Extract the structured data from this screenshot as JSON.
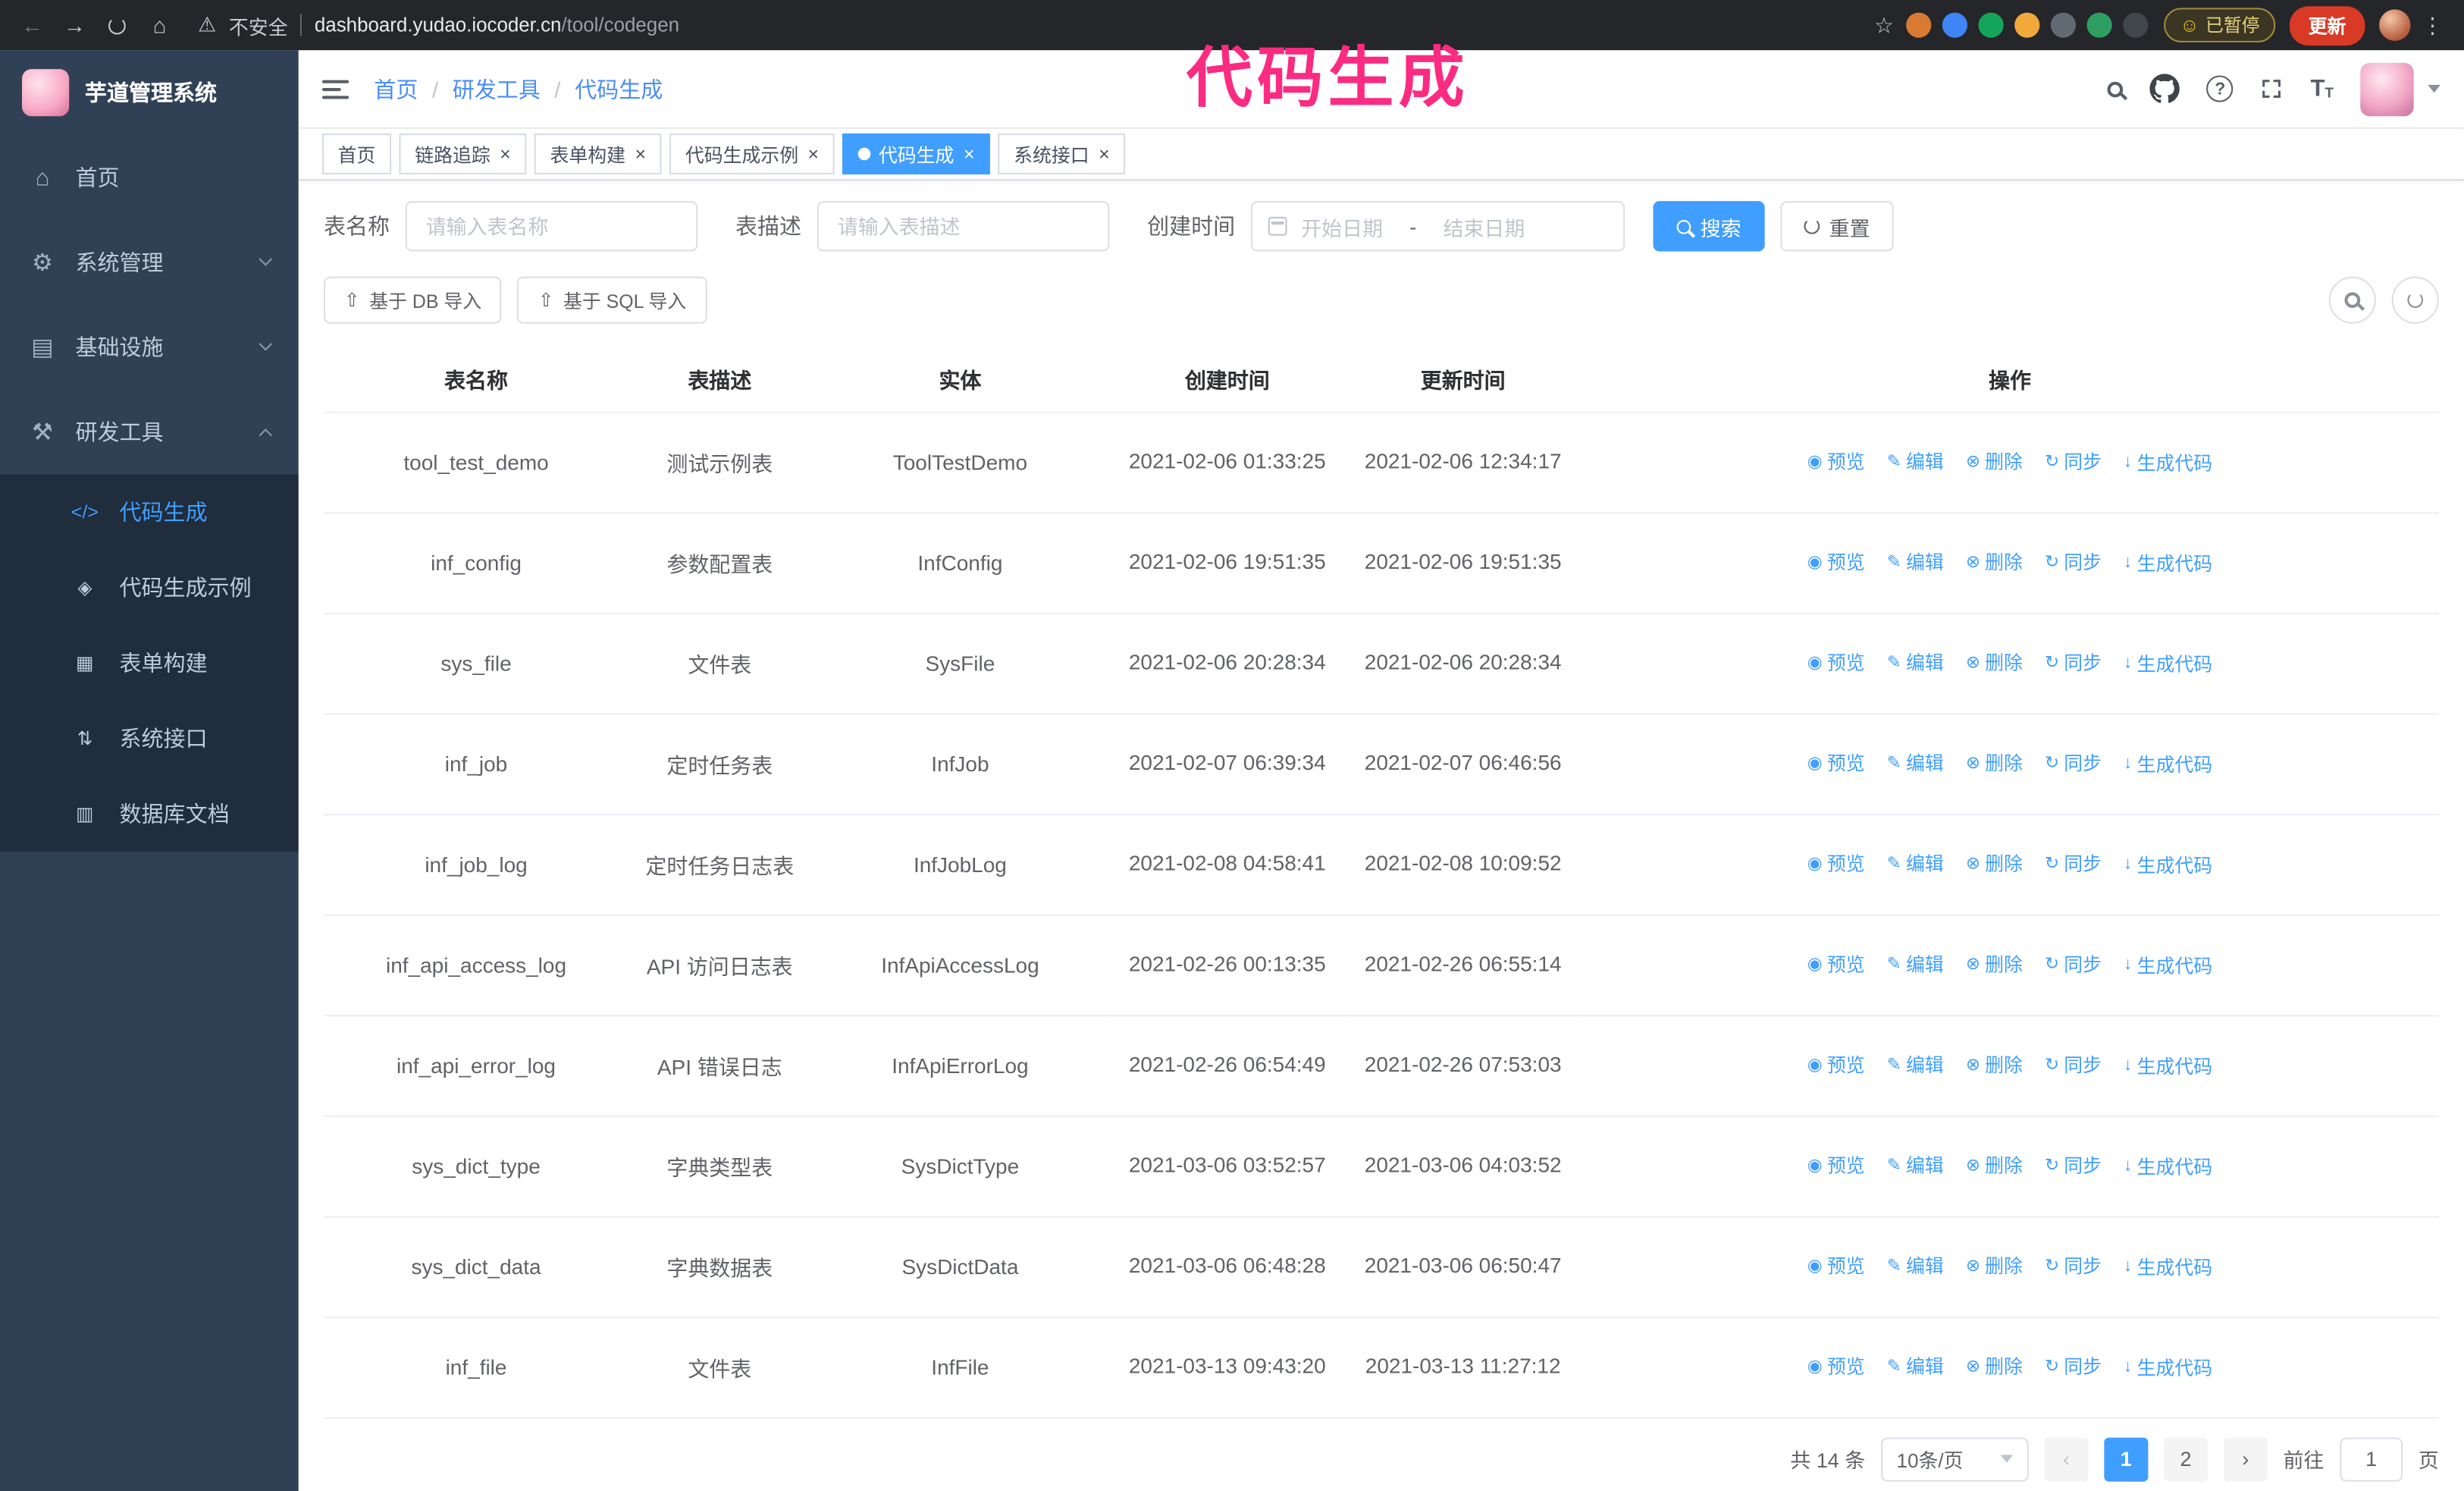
{
  "overlay_title": "代码生成",
  "colors": {
    "accent": "#409EFF",
    "overlay_pink": "#fb2b81",
    "sidebar_bg": "#304156",
    "submenu_bg": "#1f2d3d",
    "browser_bar": "#25262a",
    "update_red": "#d93a25"
  },
  "browser": {
    "security_warning": "不安全",
    "url_host": "dashboard.yudao.iocoder.cn",
    "url_path": "/tool/codegen",
    "paused_badge": "已暂停",
    "update_button": "更新",
    "extensions": [
      {
        "name": "extension-orange-icon",
        "color": "#d97a33"
      },
      {
        "name": "extension-blue-icon",
        "color": "#3f85f5"
      },
      {
        "name": "extension-green-check-icon",
        "color": "#15a55a"
      },
      {
        "name": "extension-yellow-icon",
        "color": "#f2a93b"
      },
      {
        "name": "extension-gray-icon",
        "color": "#5f6a72"
      },
      {
        "name": "extension-leaf-icon",
        "color": "#2f9e63"
      },
      {
        "name": "extension-dark-puzzle-icon",
        "color": "#41464b"
      }
    ]
  },
  "sidebar": {
    "logo_title": "芋道管理系统",
    "items": [
      {
        "label": "首页",
        "icon": "home-icon",
        "glyph": "⌂",
        "expandable": false,
        "expanded": false
      },
      {
        "label": "系统管理",
        "icon": "gear-icon",
        "glyph": "⚙",
        "expandable": true,
        "expanded": false
      },
      {
        "label": "基础设施",
        "icon": "infrastructure-icon",
        "glyph": "▤",
        "expandable": true,
        "expanded": false
      },
      {
        "label": "研发工具",
        "icon": "dev-tools-icon",
        "glyph": "⚒",
        "expandable": true,
        "expanded": true
      }
    ],
    "subitems": [
      {
        "label": "代码生成",
        "icon": "code-icon",
        "glyph": "</>",
        "active": true
      },
      {
        "label": "代码生成示例",
        "icon": "code-example-icon",
        "glyph": "◈",
        "active": false
      },
      {
        "label": "表单构建",
        "icon": "form-builder-icon",
        "glyph": "▦",
        "active": false
      },
      {
        "label": "系统接口",
        "icon": "api-icon",
        "glyph": "⇅",
        "active": false
      },
      {
        "label": "数据库文档",
        "icon": "database-doc-icon",
        "glyph": "▥",
        "active": false
      }
    ]
  },
  "header": {
    "breadcrumb": [
      {
        "label": "首页"
      },
      {
        "label": "研发工具"
      },
      {
        "label": "代码生成"
      }
    ]
  },
  "tabs": [
    {
      "label": "首页",
      "closable": false,
      "active": false
    },
    {
      "label": "链路追踪",
      "closable": true,
      "active": false
    },
    {
      "label": "表单构建",
      "closable": true,
      "active": false
    },
    {
      "label": "代码生成示例",
      "closable": true,
      "active": false
    },
    {
      "label": "代码生成",
      "closable": true,
      "active": true
    },
    {
      "label": "系统接口",
      "closable": true,
      "active": false
    }
  ],
  "filters": {
    "table_name_label": "表名称",
    "table_name_placeholder": "请输入表名称",
    "table_desc_label": "表描述",
    "table_desc_placeholder": "请输入表描述",
    "create_time_label": "创建时间",
    "date_start_placeholder": "开始日期",
    "date_separator": "-",
    "date_end_placeholder": "结束日期",
    "search_button": "搜索",
    "reset_button": "重置"
  },
  "toolbar": {
    "import_db": "基于 DB 导入",
    "import_sql": "基于 SQL 导入"
  },
  "table": {
    "columns": [
      "表名称",
      "表描述",
      "实体",
      "创建时间",
      "更新时间",
      "操作"
    ],
    "actions": [
      {
        "label": "预览",
        "name": "preview",
        "icon": "eye-icon",
        "glyph": "◉"
      },
      {
        "label": "编辑",
        "name": "edit",
        "icon": "pencil-icon",
        "glyph": "✎"
      },
      {
        "label": "删除",
        "name": "delete",
        "icon": "trash-icon",
        "glyph": "⊗"
      },
      {
        "label": "同步",
        "name": "sync",
        "icon": "sync-icon",
        "glyph": "↻"
      },
      {
        "label": "生成代码",
        "name": "generate-code",
        "icon": "download-icon",
        "glyph": "↓"
      }
    ],
    "rows": [
      {
        "name": "tool_test_demo",
        "desc": "测试示例表",
        "entity": "ToolTestDemo",
        "created": "2021-02-06 01:33:25",
        "updated": "2021-02-06 12:34:17"
      },
      {
        "name": "inf_config",
        "desc": "参数配置表",
        "entity": "InfConfig",
        "created": "2021-02-06 19:51:35",
        "updated": "2021-02-06 19:51:35"
      },
      {
        "name": "sys_file",
        "desc": "文件表",
        "entity": "SysFile",
        "created": "2021-02-06 20:28:34",
        "updated": "2021-02-06 20:28:34"
      },
      {
        "name": "inf_job",
        "desc": "定时任务表",
        "entity": "InfJob",
        "created": "2021-02-07 06:39:34",
        "updated": "2021-02-07 06:46:56"
      },
      {
        "name": "inf_job_log",
        "desc": "定时任务日志表",
        "entity": "InfJobLog",
        "created": "2021-02-08 04:58:41",
        "updated": "2021-02-08 10:09:52"
      },
      {
        "name": "inf_api_access_log",
        "desc": "API 访问日志表",
        "entity": "InfApiAccessLog",
        "created": "2021-02-26 00:13:35",
        "updated": "2021-02-26 06:55:14"
      },
      {
        "name": "inf_api_error_log",
        "desc": "API 错误日志",
        "entity": "InfApiErrorLog",
        "created": "2021-02-26 06:54:49",
        "updated": "2021-02-26 07:53:03"
      },
      {
        "name": "sys_dict_type",
        "desc": "字典类型表",
        "entity": "SysDictType",
        "created": "2021-03-06 03:52:57",
        "updated": "2021-03-06 04:03:52"
      },
      {
        "name": "sys_dict_data",
        "desc": "字典数据表",
        "entity": "SysDictData",
        "created": "2021-03-06 06:48:28",
        "updated": "2021-03-06 06:50:47"
      },
      {
        "name": "inf_file",
        "desc": "文件表",
        "entity": "InfFile",
        "created": "2021-03-13 09:43:20",
        "updated": "2021-03-13 11:27:12"
      }
    ]
  },
  "pagination": {
    "total_text": "共 14 条",
    "page_size": "10条/页",
    "pages": [
      "1",
      "2"
    ],
    "active_page": "1",
    "goto_prefix": "前往",
    "goto_value": "1",
    "goto_suffix": "页"
  }
}
